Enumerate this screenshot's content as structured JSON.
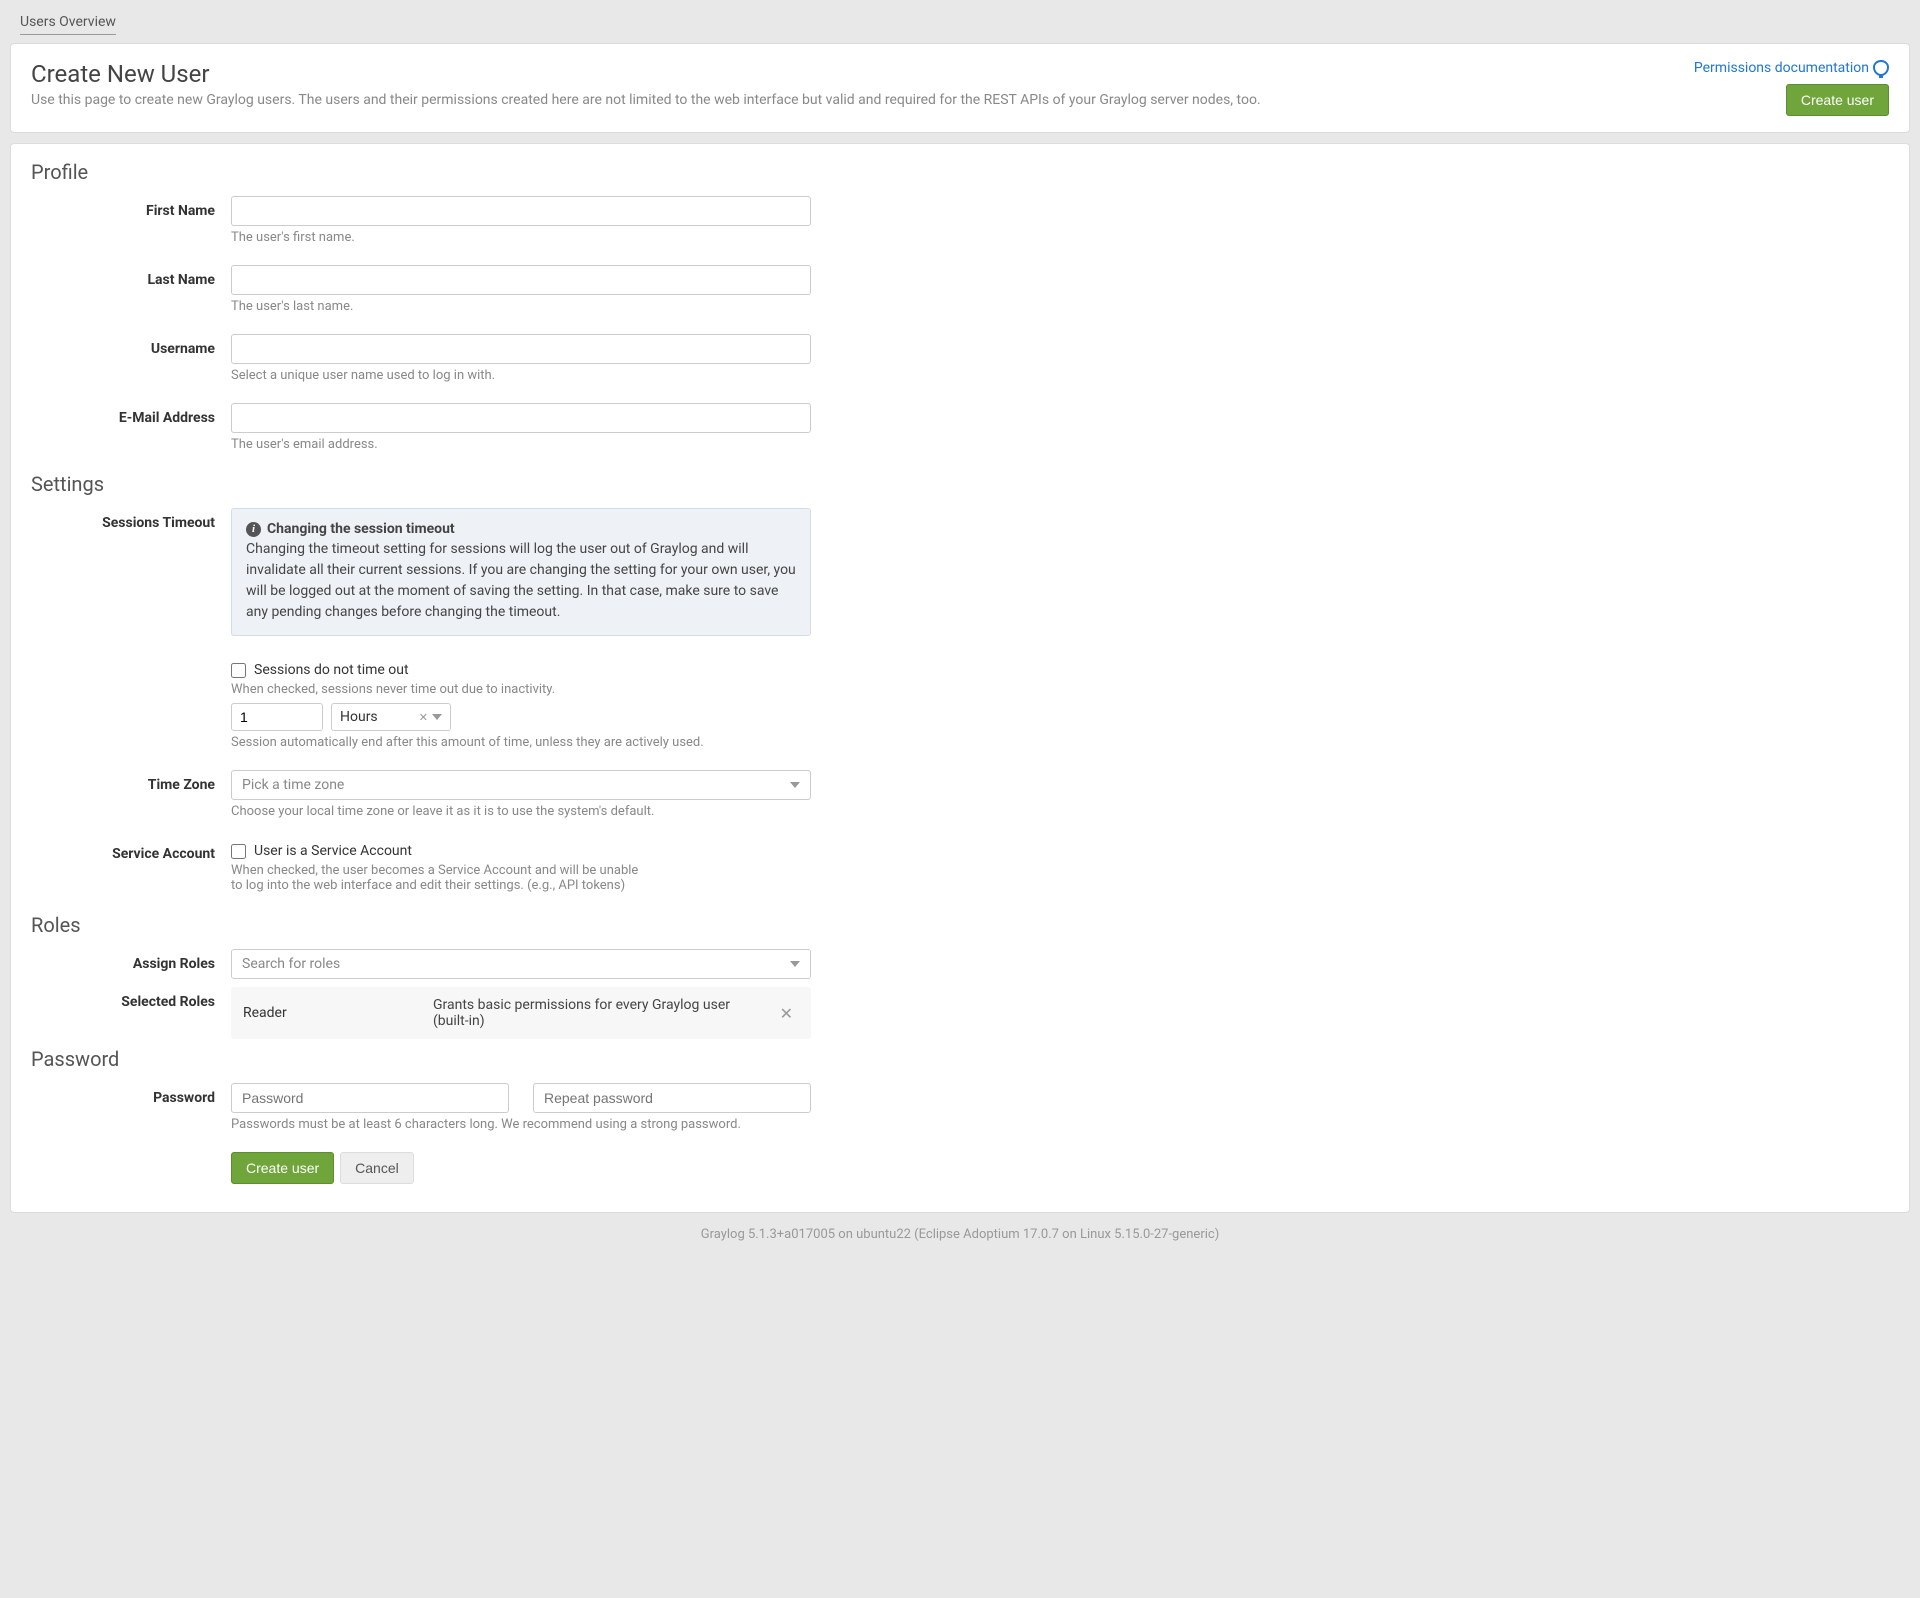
{
  "breadcrumb": "Users Overview",
  "header": {
    "title": "Create New User",
    "description": "Use this page to create new Graylog users. The users and their permissions created here are not limited to the web interface but valid and required for the REST APIs of your Graylog server nodes, too.",
    "doc_link": "Permissions documentation",
    "create_button": "Create user"
  },
  "sections": {
    "profile": {
      "title": "Profile",
      "first_name": {
        "label": "First Name",
        "help": "The user's first name."
      },
      "last_name": {
        "label": "Last Name",
        "help": "The user's last name."
      },
      "username": {
        "label": "Username",
        "help": "Select a unique user name used to log in with."
      },
      "email": {
        "label": "E-Mail Address",
        "help": "The user's email address."
      }
    },
    "settings": {
      "title": "Settings",
      "sessions_timeout": {
        "label": "Sessions Timeout",
        "info_title": "Changing the session timeout",
        "info_body": "Changing the timeout setting for sessions will log the user out of Graylog and will invalidate all their current sessions. If you are changing the setting for your own user, you will be logged out at the moment of saving the setting. In that case, make sure to save any pending changes before changing the timeout.",
        "checkbox_label": "Sessions do not time out",
        "checkbox_help": "When checked, sessions never time out due to inactivity.",
        "timeout_value": "1",
        "timeout_unit": "Hours",
        "timeout_help": "Session automatically end after this amount of time, unless they are actively used."
      },
      "time_zone": {
        "label": "Time Zone",
        "placeholder": "Pick a time zone",
        "help": "Choose your local time zone or leave it as it is to use the system's default."
      },
      "service_account": {
        "label": "Service Account",
        "checkbox_label": "User is a Service Account",
        "help": "When checked, the user becomes a Service Account and will be unable to log into the web interface and edit their settings. (e.g., API tokens)"
      }
    },
    "roles": {
      "title": "Roles",
      "assign": {
        "label": "Assign Roles",
        "placeholder": "Search for roles"
      },
      "selected": {
        "label": "Selected Roles",
        "items": [
          {
            "name": "Reader",
            "desc": "Grants basic permissions for every Graylog user (built-in)"
          }
        ]
      }
    },
    "password": {
      "title": "Password",
      "label": "Password",
      "placeholder": "Password",
      "repeat_placeholder": "Repeat password",
      "help": "Passwords must be at least 6 characters long. We recommend using a strong password."
    }
  },
  "actions": {
    "create": "Create user",
    "cancel": "Cancel"
  },
  "footer": "Graylog 5.1.3+a017005 on ubuntu22 (Eclipse Adoptium 17.0.7 on Linux 5.15.0-27-generic)"
}
